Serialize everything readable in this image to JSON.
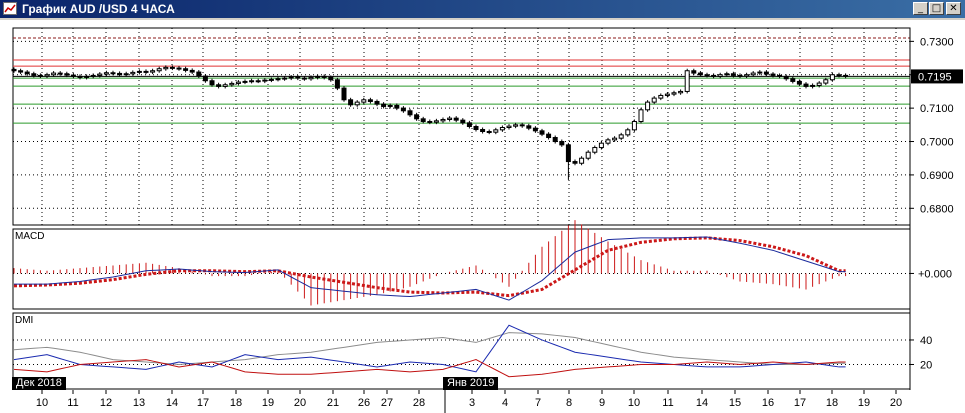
{
  "window": {
    "title": "График AUD /USD  4 ЧАСА",
    "buttons": [
      {
        "icon": "minimize-icon",
        "glyph": "_"
      },
      {
        "icon": "restore-icon",
        "glyph": "□"
      },
      {
        "icon": "close-icon",
        "glyph": "✕"
      }
    ]
  },
  "colors": {
    "title_bar": "#0a246a",
    "bull_candle": "#ffffff",
    "bear_candle": "#000000",
    "level_dark_red": "#8b1a1a",
    "level_red": "#e03030",
    "level_green": "#2a9a2a",
    "macd_line": "#1a2a9c",
    "macd_signal": "#cc1818",
    "macd_hist": "#cc1818",
    "dmi_adx": "#8c8c8c",
    "dmi_plus": "#1a2ab0",
    "dmi_minus": "#c01010"
  },
  "chart_data": [
    {
      "type": "bar",
      "xlabel": "",
      "ylabel": "",
      "ylim": [
        0.675,
        0.734
      ],
      "y_ticks": [
        0.73,
        0.72,
        0.71,
        0.7,
        0.69,
        0.68
      ],
      "y_tick_labels": [
        "0.7300",
        "0.7200",
        "0.7100",
        "0.7000",
        "0.6900",
        "0.6800"
      ],
      "last_price_label": "0.7195",
      "last_price": 0.7195,
      "x_tick_labels": [
        "10",
        "11",
        "12",
        "13",
        "14",
        "17",
        "18",
        "19",
        "20",
        "21",
        "26",
        "27",
        "28",
        "3",
        "4",
        "7",
        "8",
        "9",
        "10",
        "11",
        "14",
        "15",
        "16",
        "17",
        "18",
        "19",
        "20"
      ],
      "month_tags": [
        "Дек 2018",
        "Янв 2019"
      ],
      "levels": [
        {
          "value": 0.731,
          "style": "dashed",
          "color": "#8b1a1a"
        },
        {
          "value": 0.7244,
          "style": "solid",
          "color": "#e03030"
        },
        {
          "value": 0.7226,
          "style": "solid",
          "color": "#e03030"
        },
        {
          "value": 0.719,
          "style": "solid",
          "color": "#2a9a2a"
        },
        {
          "value": 0.7166,
          "style": "solid",
          "color": "#2a9a2a"
        },
        {
          "value": 0.7112,
          "style": "solid",
          "color": "#2a9a2a"
        },
        {
          "value": 0.7055,
          "style": "solid",
          "color": "#2a9a2a"
        }
      ],
      "spike": {
        "index": 84,
        "low": 0.6885
      },
      "close": [
        0.7212,
        0.7208,
        0.7203,
        0.7198,
        0.7196,
        0.72,
        0.7205,
        0.7203,
        0.7199,
        0.7195,
        0.7192,
        0.7195,
        0.7198,
        0.7202,
        0.7206,
        0.7204,
        0.72,
        0.7203,
        0.7207,
        0.721,
        0.7208,
        0.7212,
        0.7218,
        0.7222,
        0.722,
        0.7218,
        0.7213,
        0.7208,
        0.7196,
        0.7182,
        0.717,
        0.7165,
        0.717,
        0.7174,
        0.7178,
        0.718,
        0.7182,
        0.7181,
        0.7184,
        0.7186,
        0.7188,
        0.719,
        0.7193,
        0.719,
        0.7188,
        0.7192,
        0.7195,
        0.7192,
        0.7185,
        0.716,
        0.7125,
        0.711,
        0.7118,
        0.7125,
        0.712,
        0.7112,
        0.7105,
        0.7108,
        0.71,
        0.7092,
        0.708,
        0.7068,
        0.706,
        0.7058,
        0.7062,
        0.7066,
        0.707,
        0.7064,
        0.7056,
        0.7045,
        0.7036,
        0.703,
        0.7028,
        0.7035,
        0.7042,
        0.7046,
        0.705,
        0.7047,
        0.704,
        0.7032,
        0.7022,
        0.7012,
        0.7,
        0.699,
        0.694,
        0.6935,
        0.695,
        0.6968,
        0.6982,
        0.6995,
        0.7005,
        0.701,
        0.702,
        0.7035,
        0.706,
        0.7095,
        0.7118,
        0.713,
        0.7138,
        0.7142,
        0.7146,
        0.715,
        0.7212,
        0.7205,
        0.72,
        0.7198,
        0.7195,
        0.72,
        0.7203,
        0.7198,
        0.7196,
        0.72,
        0.7205,
        0.7208,
        0.7202,
        0.7198,
        0.7195,
        0.7188,
        0.718,
        0.7172,
        0.7165,
        0.7168,
        0.7175,
        0.7185,
        0.72,
        0.7198,
        0.7195
      ]
    },
    {
      "type": "line",
      "label": "MACD",
      "y_tick_labels": [
        "+0.000"
      ],
      "ylim": [
        -0.004,
        0.005
      ],
      "sample_step": 5,
      "series": [
        {
          "values": [
            -0.0012,
            -0.0012,
            -0.0009,
            -0.0004,
            0.0003,
            0.0005,
            0.0002,
            0.0001,
            0.0004,
            -0.0016,
            -0.002,
            -0.0024,
            -0.0026,
            -0.0022,
            -0.0018,
            -0.003,
            -0.0008,
            0.0024,
            0.0038,
            0.004,
            0.004,
            0.0041,
            0.0034,
            0.0026,
            0.0014,
            0.0002
          ]
        },
        {
          "values": [
            -0.0014,
            -0.0013,
            -0.0011,
            -0.0007,
            -0.0001,
            0.0003,
            0.0003,
            0.0002,
            0.0003,
            -0.0004,
            -0.001,
            -0.0016,
            -0.0021,
            -0.0022,
            -0.0021,
            -0.0025,
            -0.0018,
            0.0004,
            0.0026,
            0.0035,
            0.0039,
            0.004,
            0.0037,
            0.003,
            0.002,
            0.0003
          ]
        }
      ]
    },
    {
      "type": "line",
      "label": "DMI",
      "y_ticks": [
        40,
        20
      ],
      "y_tick_labels": [
        "40",
        "20"
      ],
      "ylim": [
        0,
        62
      ],
      "sample_step": 5,
      "series": [
        {
          "values": [
            32,
            34,
            30,
            24,
            22,
            20,
            22,
            24,
            28,
            30,
            34,
            38,
            40,
            42,
            38,
            46,
            45,
            42,
            36,
            30,
            26,
            24,
            22,
            20,
            20,
            21
          ]
        },
        {
          "values": [
            24,
            28,
            20,
            18,
            16,
            22,
            18,
            28,
            24,
            26,
            22,
            18,
            22,
            20,
            14,
            52,
            40,
            30,
            26,
            22,
            20,
            18,
            18,
            20,
            22,
            18
          ]
        },
        {
          "values": [
            16,
            14,
            20,
            22,
            24,
            18,
            22,
            14,
            12,
            12,
            14,
            16,
            14,
            16,
            24,
            10,
            12,
            16,
            18,
            20,
            20,
            22,
            20,
            22,
            20,
            22
          ]
        }
      ]
    }
  ]
}
